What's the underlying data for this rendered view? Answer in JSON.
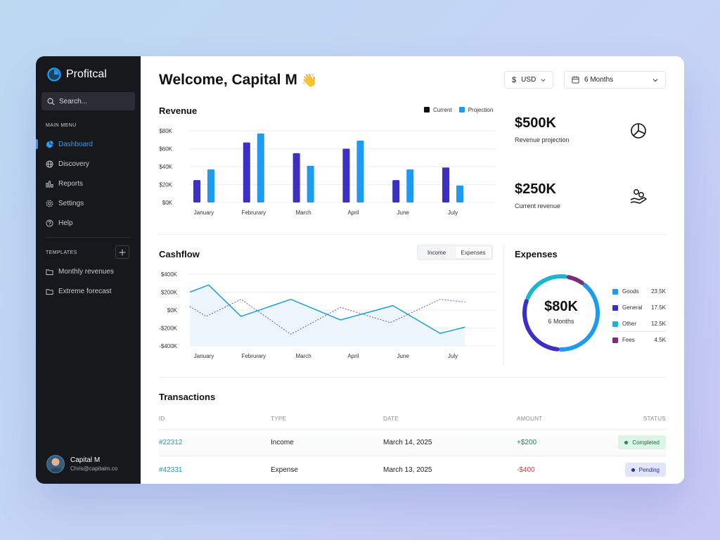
{
  "app": {
    "name": "Profitcal"
  },
  "sidebar": {
    "search_placeholder": "Search...",
    "main_menu_label": "MAIN MENU",
    "items": [
      {
        "label": "Dashboard",
        "icon": "pie-chart-icon",
        "active": true
      },
      {
        "label": "Discovery",
        "icon": "globe-icon"
      },
      {
        "label": "Reports",
        "icon": "bar-chart-icon"
      },
      {
        "label": "Settings",
        "icon": "gear-icon"
      },
      {
        "label": "Help",
        "icon": "help-circle-icon"
      }
    ],
    "templates_label": "TEMPLATES",
    "templates": [
      {
        "label": "Monthly revenues",
        "icon": "folder-icon"
      },
      {
        "label": "Extreme forecast",
        "icon": "folder-icon"
      }
    ],
    "user": {
      "name": "Capital M",
      "email": "Chris@capitaim.co"
    },
    "accent": "#2d9cf0"
  },
  "header": {
    "welcome": "Welcome, Capital M",
    "emoji": "👋",
    "currency": "USD",
    "period": "6 Months"
  },
  "revenue": {
    "title": "Revenue",
    "legend": {
      "current": "Current",
      "projection": "Projection"
    },
    "colors": {
      "current": "#3c2fc4",
      "projection": "#1d9bf0"
    },
    "kpis": [
      {
        "value": "$500K",
        "label": "Revenue projection",
        "icon": "pie-chart-icon",
        "bg": "#dff0fc"
      },
      {
        "value": "$250K",
        "label": "Current revenue",
        "icon": "hand-coins-icon",
        "bg": "#e6e9fd"
      }
    ]
  },
  "cashflow": {
    "title": "Cashflow",
    "tabs": [
      "Income",
      "Expenses"
    ],
    "active_tab": "Expenses"
  },
  "expenses": {
    "title": "Expenses",
    "total": "$80K",
    "period": "6 Months",
    "items": [
      {
        "name": "Goods",
        "value": "23.5K",
        "color": "#1d9bf0"
      },
      {
        "name": "General",
        "value": "17.5K",
        "color": "#3c2fc4"
      },
      {
        "name": "Other",
        "value": "12.5K",
        "color": "#1bb5d0"
      },
      {
        "name": "Fees",
        "value": "4.5K",
        "color": "#7b2d7a"
      }
    ]
  },
  "transactions": {
    "title": "Transactions",
    "columns": [
      "ID",
      "TYPE",
      "DATE",
      "AMOUNT",
      "STATUS"
    ],
    "rows": [
      {
        "id": "#22312",
        "type": "Income",
        "date": "March 14, 2025",
        "amount": "+$200",
        "status": "Completed"
      },
      {
        "id": "#42331",
        "type": "Expense",
        "date": "March 13, 2025",
        "amount": "-$400",
        "status": "Pending"
      }
    ]
  },
  "chart_data": [
    {
      "type": "bar",
      "title": "Revenue",
      "categories": [
        "January",
        "Februrary",
        "March",
        "April",
        "June",
        "July"
      ],
      "y_ticks": [
        "$80K",
        "$60K",
        "$40K",
        "$20K",
        "$0K"
      ],
      "ylim": [
        0,
        80
      ],
      "grid": true,
      "legend": "top-right",
      "series": [
        {
          "name": "Current",
          "values": [
            25,
            67,
            55,
            60,
            25,
            39
          ]
        },
        {
          "name": "Projection",
          "values": [
            37,
            77,
            41,
            69,
            37,
            19
          ]
        }
      ]
    },
    {
      "type": "line",
      "title": "Cashflow",
      "categories": [
        "January",
        "Februrary",
        "March",
        "April",
        "June",
        "July"
      ],
      "y_ticks": [
        "$400K",
        "$200K",
        "$0K",
        "-$200K",
        "-$400K"
      ],
      "ylim": [
        -400,
        400
      ],
      "grid": true,
      "series": [
        {
          "name": "Income",
          "x": [
            0,
            0.35,
            1.0,
            2.0,
            3.0,
            4.05,
            5.0,
            5.5
          ],
          "values": [
            200,
            280,
            -70,
            120,
            -110,
            50,
            -260,
            -190
          ]
        },
        {
          "name": "Expenses",
          "x": [
            0,
            0.3,
            1.0,
            2.0,
            3.0,
            4.0,
            5.0,
            5.5
          ],
          "values": [
            40,
            -70,
            120,
            -270,
            30,
            -140,
            120,
            90
          ]
        }
      ]
    },
    {
      "type": "pie",
      "title": "Expenses",
      "categories": [
        "Goods",
        "General",
        "Other",
        "Fees"
      ],
      "values": [
        23.5,
        17.5,
        12.5,
        4.5
      ]
    }
  ]
}
